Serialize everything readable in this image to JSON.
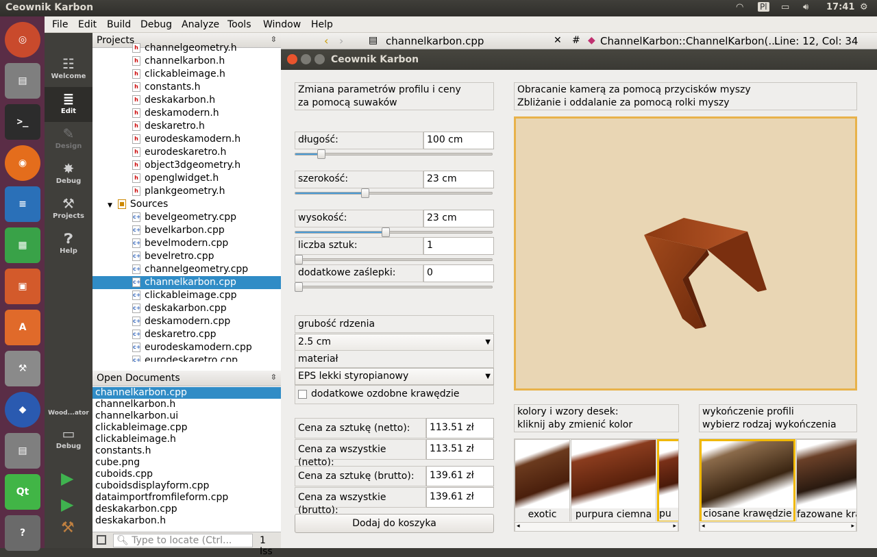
{
  "topbar": {
    "title": "Ceownik Karbon",
    "keyboard": "Pl",
    "time": "17:41"
  },
  "menu": [
    "File",
    "Edit",
    "Build",
    "Debug",
    "Analyze",
    "Tools",
    "Window",
    "Help"
  ],
  "modes": [
    {
      "label": "Welcome",
      "icon": "grid-icon"
    },
    {
      "label": "Edit",
      "icon": "document-icon"
    },
    {
      "label": "Design",
      "icon": "pen-icon"
    },
    {
      "label": "Debug",
      "icon": "bug-icon"
    },
    {
      "label": "Projects",
      "icon": "wrench-icon"
    },
    {
      "label": "Help",
      "icon": "help-icon"
    }
  ],
  "kit": {
    "name": "Wood...ator",
    "mode": "Debug"
  },
  "projects": {
    "header": "Projects",
    "headers": [
      "channelgeometry.h",
      "channelkarbon.h",
      "clickableimage.h",
      "constants.h",
      "deskakarbon.h",
      "deskamodern.h",
      "deskaretro.h",
      "eurodeskamodern.h",
      "eurodeskaretro.h",
      "object3dgeometry.h",
      "openglwidget.h",
      "plankgeometry.h"
    ],
    "sources_label": "Sources",
    "sources": [
      "bevelgeometry.cpp",
      "bevelkarbon.cpp",
      "bevelmodern.cpp",
      "bevelretro.cpp",
      "channelgeometry.cpp",
      "channelkarbon.cpp",
      "clickableimage.cpp",
      "deskakarbon.cpp",
      "deskamodern.cpp",
      "deskaretro.cpp",
      "eurodeskamodern.cpp",
      "eurodeskaretro.cpp"
    ]
  },
  "open_docs": {
    "header": "Open Documents",
    "items": [
      "channelkarbon.cpp",
      "channelkarbon.h",
      "channelkarbon.ui",
      "clickableimage.cpp",
      "clickableimage.h",
      "constants.h",
      "cube.png",
      "cuboids.cpp",
      "cuboidsdisplayform.cpp",
      "dataimportfromfileform.cpp",
      "deskakarbon.cpp",
      "deskakarbon.h"
    ]
  },
  "locator": {
    "placeholder": "Type to locate (Ctrl...",
    "issues": "1 Iss"
  },
  "editor": {
    "file": "channelkarbon.cpp",
    "symbol": "ChannelKarbon::ChannelKarbon(...",
    "position": "Line: 12, Col: 34"
  },
  "dialog": {
    "title": "Ceownik Karbon",
    "info_left": [
      "Zmiana parametrów profilu i ceny",
      "za pomocą suwaków"
    ],
    "info_right": [
      "Obracanie kamerą za pomocą przycisków myszy",
      "Zbliżanie i oddalanie za pomocą rolki myszy"
    ],
    "params": [
      {
        "label": "długość:",
        "value": "100 cm",
        "slider": 0.12
      },
      {
        "label": "szerokość:",
        "value": "23 cm",
        "slider": 0.35
      },
      {
        "label": "wysokość:",
        "value": "23 cm",
        "slider": 0.46
      },
      {
        "label": "liczba sztuk:",
        "value": "1",
        "slider": 0.0
      },
      {
        "label": "dodatkowe zaślepki:",
        "value": "0",
        "slider": 0.0
      }
    ],
    "core_label": "grubość rdzenia",
    "core_value": "2.5 cm",
    "material_label": "materiał",
    "material_value": "EPS lekki styropianowy",
    "extra_edges": "dodatkowe ozdobne krawędzie",
    "extra_edges_checked": false,
    "prices": [
      {
        "label": "Cena za sztukę (netto):",
        "value": "113.51 zł"
      },
      {
        "label": "Cena za wszystkie (netto):",
        "value": "113.51 zł"
      },
      {
        "label": "Cena za sztukę (brutto):",
        "value": "139.61 zł"
      },
      {
        "label": "Cena za wszystkie (brutto):",
        "value": "139.61 zł"
      }
    ],
    "add_button": "Dodaj do koszyka",
    "colors_info": [
      "kolory i wzory desek:",
      "kliknij aby zmienić kolor"
    ],
    "color_thumbs": [
      "exotic",
      "purpura ciemna",
      "pu"
    ],
    "finish_info": [
      "wykończenie profili",
      "wybierz rodzaj wykończenia"
    ],
    "finish_thumbs": [
      "ciosane krawędzie",
      "fazowane kra"
    ]
  },
  "colors": {
    "accent": "#308cc6",
    "selected_border": "#f0b800",
    "viewport_bg": "#e9d6b4",
    "viewport_border": "#e8b24a",
    "wood": "#8a3a14"
  }
}
